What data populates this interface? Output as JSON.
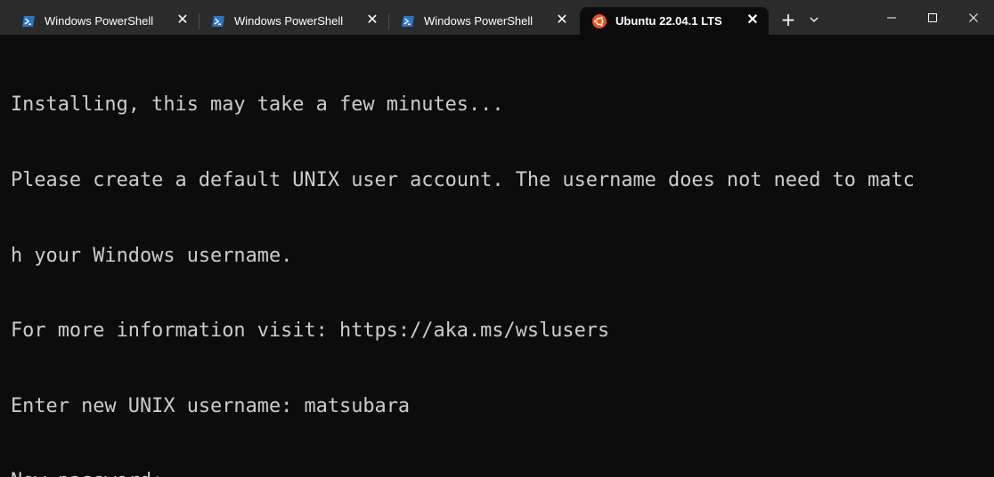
{
  "tabs": [
    {
      "label": "Windows PowerShell",
      "icon": "powershell-icon",
      "active": false
    },
    {
      "label": "Windows PowerShell",
      "icon": "powershell-icon",
      "active": false
    },
    {
      "label": "Windows PowerShell",
      "icon": "powershell-icon",
      "active": false
    },
    {
      "label": "Ubuntu 22.04.1 LTS",
      "icon": "ubuntu-icon",
      "active": true
    }
  ],
  "titlebar": {
    "new_tab_label": "+",
    "close_glyph": "✕"
  },
  "colors": {
    "background": "#0c0c0c",
    "text": "#cccccc",
    "titlebar": "#2b2b2b",
    "powershell": "#2d74c3",
    "ubuntu": "#e95420"
  },
  "terminal": {
    "lines": [
      "Installing, this may take a few minutes...",
      "Please create a default UNIX user account. The username does not need to matc",
      "h your Windows username.",
      "For more information visit: https://aka.ms/wslusers",
      "Enter new UNIX username: matsubara",
      "New password:"
    ]
  }
}
